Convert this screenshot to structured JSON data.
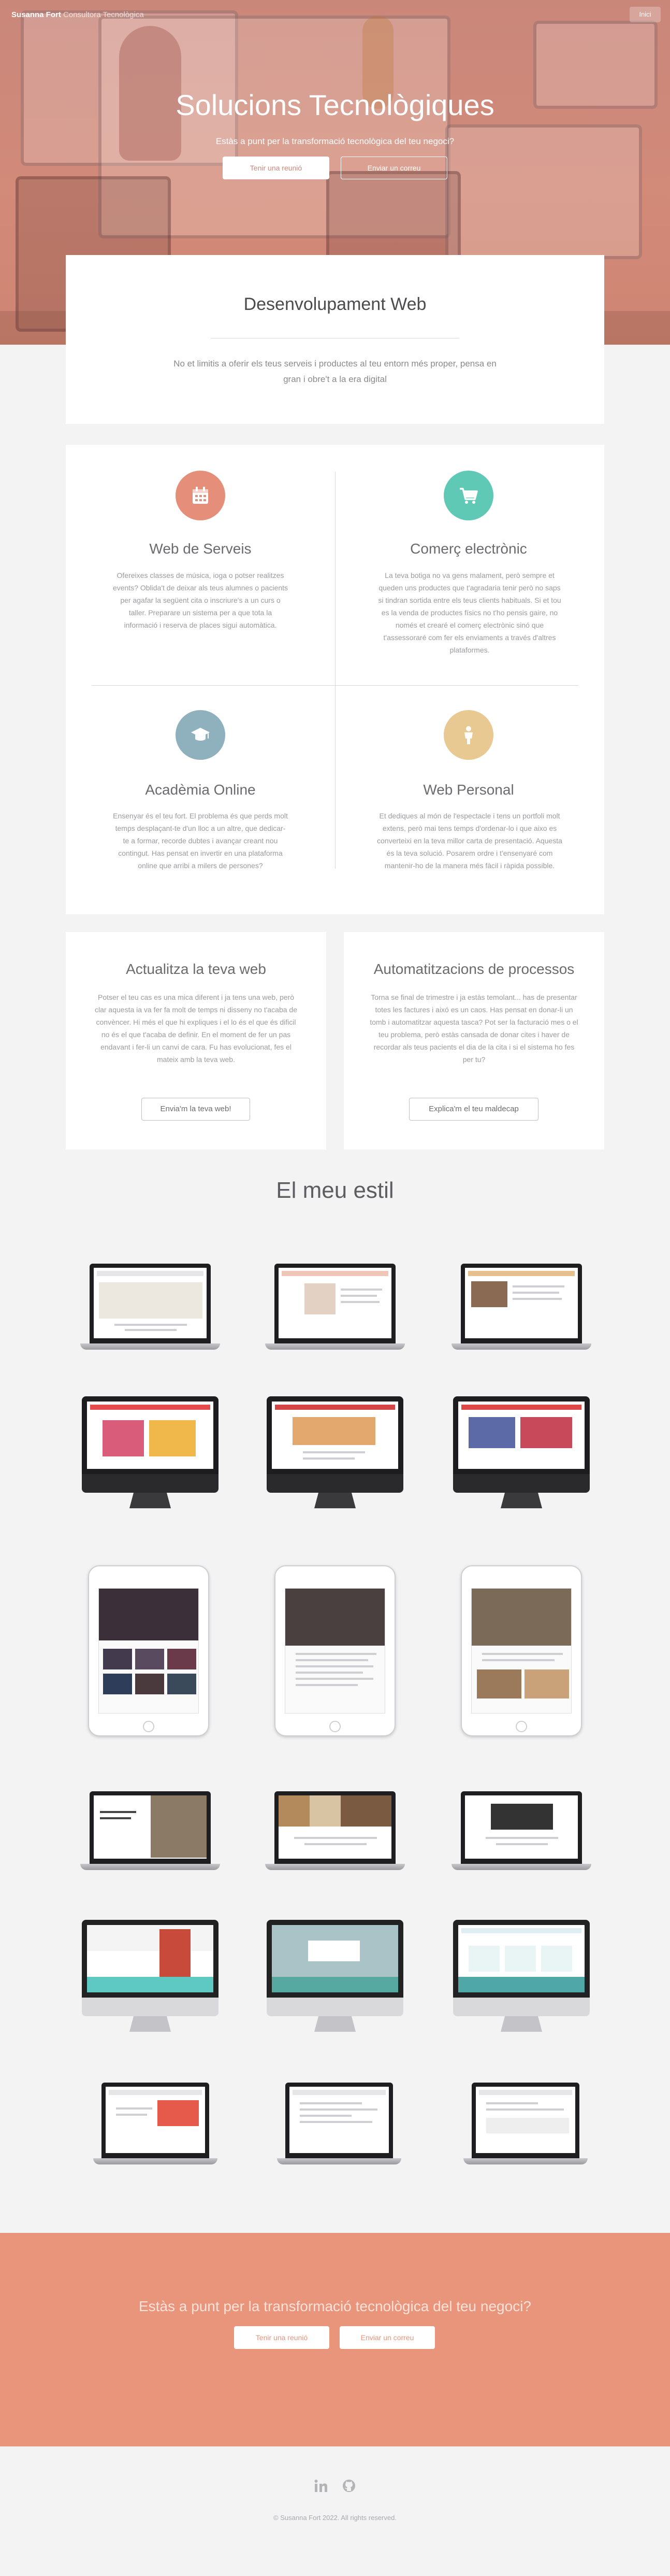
{
  "navbar": {
    "brand_name": "Susanna Fort",
    "brand_sub": "Consultora Tecnològica",
    "menu_label": "Inici"
  },
  "hero": {
    "title": "Solucions Tecnològiques",
    "subtitle": "Estàs a punt per la transformació tecnològica del teu negoci?",
    "btn_meeting": "Tenir una reunió",
    "btn_email": "Enviar un correu"
  },
  "webdev": {
    "title": "Desenvolupament Web",
    "text": "No et limitis a oferir els teus serveis i productes al teu entorn més proper, pensa en gran i obre't a la era digital"
  },
  "services": [
    {
      "icon": "calendar-icon",
      "color": "#e58f7b",
      "title": "Web de Serveis",
      "text": "Ofereixes classes de música, ioga o potser realitzes events? Oblida't de deixar als teus alumnes o pacients per agafar la següent cita o inscriure's a un curs o taller. Preparare un sistema per a que tota la informació i reserva de places sigui automàtica."
    },
    {
      "icon": "cart-icon",
      "color": "#5fc9b5",
      "title": "Comerç electrònic",
      "text": "La teva botiga no va gens malament, però sempre et queden uns productes que t'agradaria tenir però no saps si tindran sortida entre els teus clients habituals. Si et tou es la venda de productes físics no t'ho pensis gaire, no només et crearé el comerç electrònic sinó que t'assessoraré com fer els enviaments a través d'altres plataformes."
    },
    {
      "icon": "graduation-cap-icon",
      "color": "#8fb0bd",
      "title": "Acadèmia Online",
      "text": "Ensenyar és el teu fort. El problema és que perds molt temps desplaçant-te d'un lloc a un altre, que dedicar-te a formar, recorde dubtes i avançar creant nou contingut. Has pensat en invertir en una plataforma online que arribi a milers de persones?"
    },
    {
      "icon": "person-icon",
      "color": "#e7c991",
      "title": "Web Personal",
      "text": "Et dediques al món de l'espectacle i tens un portfoli molt extens, però mai tens temps d'ordenar-lo i que aixo es converteixi en la teva millor carta de presentació. Aquesta és la teva solució. Posarem ordre i t'ensenyaré com mantenir-ho de la manera més fàcil i ràpida possible."
    }
  ],
  "update": {
    "title": "Actualitza la teva web",
    "text": "Potser el teu cas es una mica diferent i ja tens una web, però clar aquesta ia va fer fa molt de temps ni disseny no t'acaba de convèncer. Hi més el que hi expliques i el lo és el que és dificil no és el que t'acaba de definir. En el moment de fer un pas endavant i fer-li un canvi de cara. Fu has evolucionat, fes el mateix amb la teva web.",
    "button": "Envia'm la teva web!"
  },
  "automation": {
    "title": "Automatitzacions de processos",
    "text": "Torna se final de trimestre i ja estàs temolant... has de presentar totes les factures i aixó es un caos. Has pensat en donar-li un tomb i automatitzar aquesta tasca? Pot ser la facturació mes o el teu problema, però estàs cansada de donar cites i haver de recordar als teus pacients el dia de la cita i si el sistema ho fes per tu?",
    "button": "Explica'm el teu maldecap"
  },
  "style": {
    "title": "El meu estil"
  },
  "cta": {
    "title": "Estàs a punt per la transformació tecnològica del teu negoci?",
    "btn_meeting": "Tenir una reunió",
    "btn_email": "Enviar un correu"
  },
  "footer": {
    "icons": [
      "linkedin-icon",
      "github-icon"
    ],
    "copyright": "© Susanna Fort 2022. All rights reserved."
  }
}
